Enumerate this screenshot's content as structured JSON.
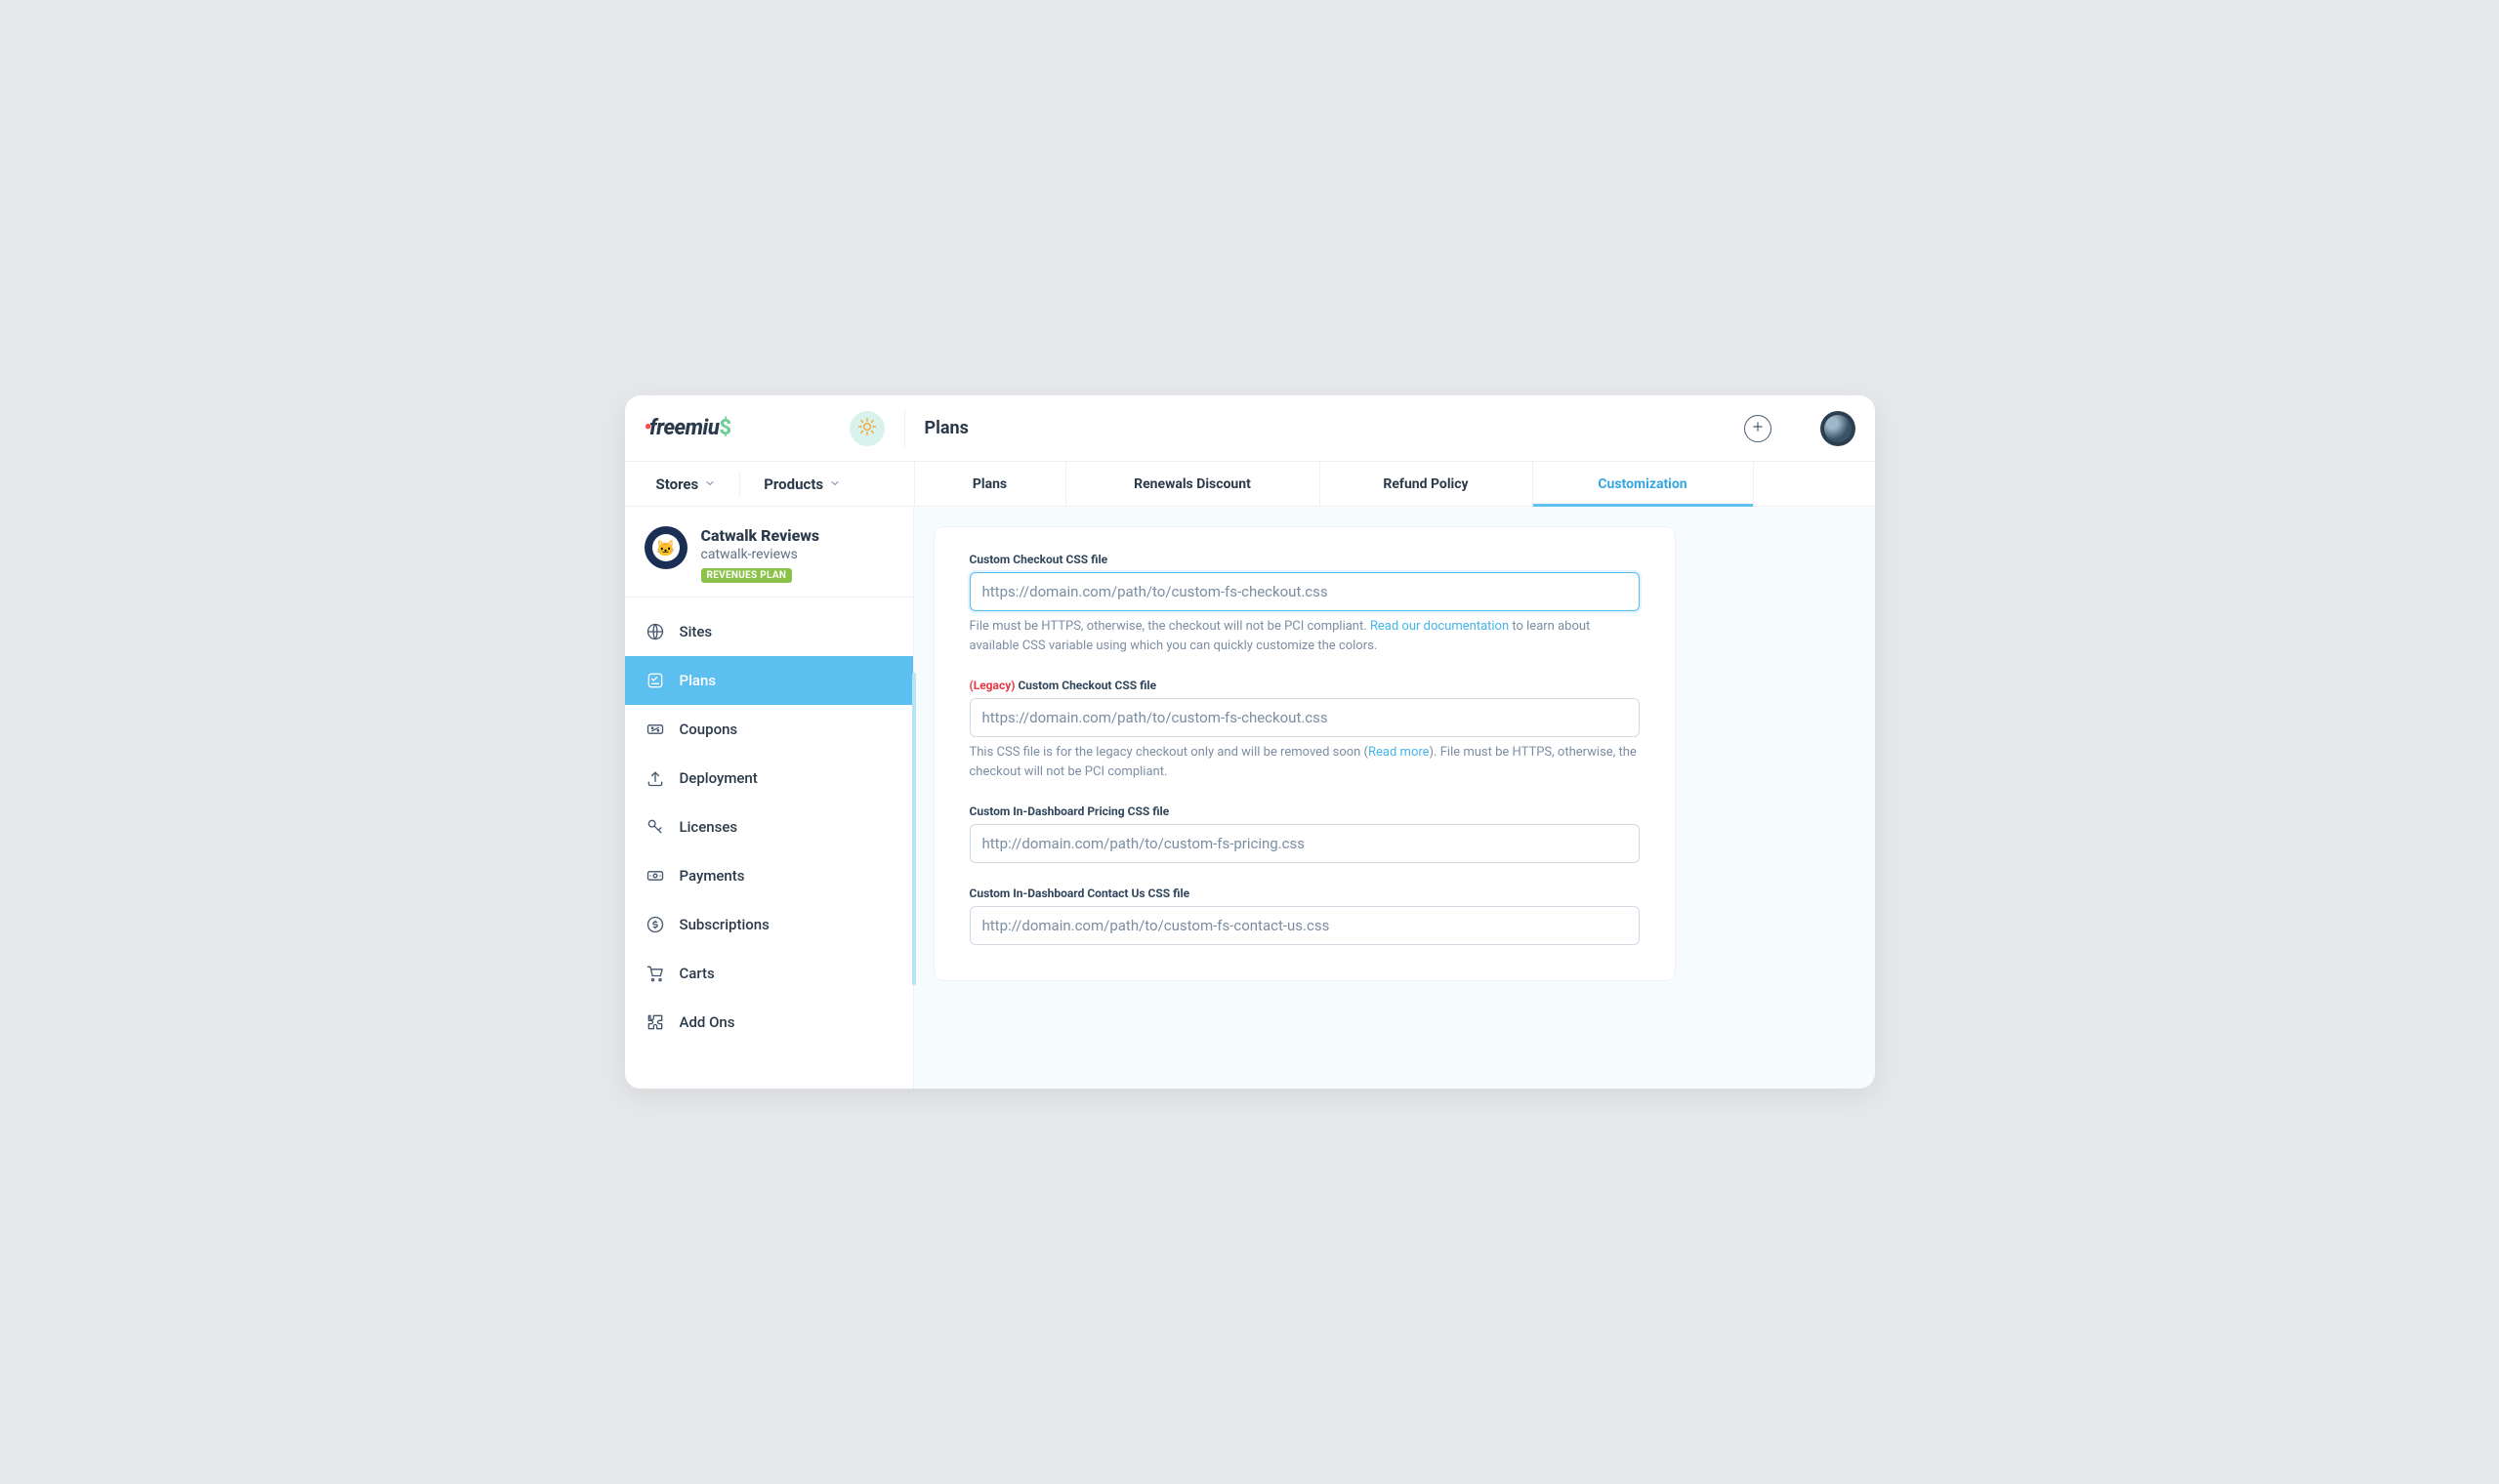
{
  "header": {
    "page_title": "Plans"
  },
  "nav": {
    "stores_label": "Stores",
    "products_label": "Products"
  },
  "tabs": [
    {
      "label": "Plans"
    },
    {
      "label": "Renewals Discount"
    },
    {
      "label": "Refund Policy"
    },
    {
      "label": "Customization"
    }
  ],
  "product": {
    "name": "Catwalk Reviews",
    "slug": "catwalk-reviews",
    "badge": "REVENUES PLAN"
  },
  "sidebar": {
    "items": [
      {
        "label": "Sites"
      },
      {
        "label": "Plans"
      },
      {
        "label": "Coupons"
      },
      {
        "label": "Deployment"
      },
      {
        "label": "Licenses"
      },
      {
        "label": "Payments"
      },
      {
        "label": "Subscriptions"
      },
      {
        "label": "Carts"
      },
      {
        "label": "Add Ons"
      }
    ]
  },
  "form": {
    "checkout_css": {
      "label": "Custom Checkout CSS file",
      "placeholder": "https://domain.com/path/to/custom-fs-checkout.css",
      "help_pre": "File must be HTTPS, otherwise, the checkout will not be PCI compliant. ",
      "help_link": "Read our documentation",
      "help_post": " to learn about available CSS variable using which you can quickly customize the colors."
    },
    "legacy_checkout_css": {
      "legacy_tag": "(Legacy)",
      "label": "Custom Checkout CSS file",
      "placeholder": "https://domain.com/path/to/custom-fs-checkout.css",
      "help_pre": "This CSS file is for the legacy checkout only and will be removed soon (",
      "help_link": "Read more",
      "help_post": "). File must be HTTPS, otherwise, the checkout will not be PCI compliant."
    },
    "pricing_css": {
      "label": "Custom In-Dashboard Pricing CSS file",
      "placeholder": "http://domain.com/path/to/custom-fs-pricing.css"
    },
    "contact_css": {
      "label": "Custom In-Dashboard Contact Us CSS file",
      "placeholder": "http://domain.com/path/to/custom-fs-contact-us.css"
    }
  }
}
